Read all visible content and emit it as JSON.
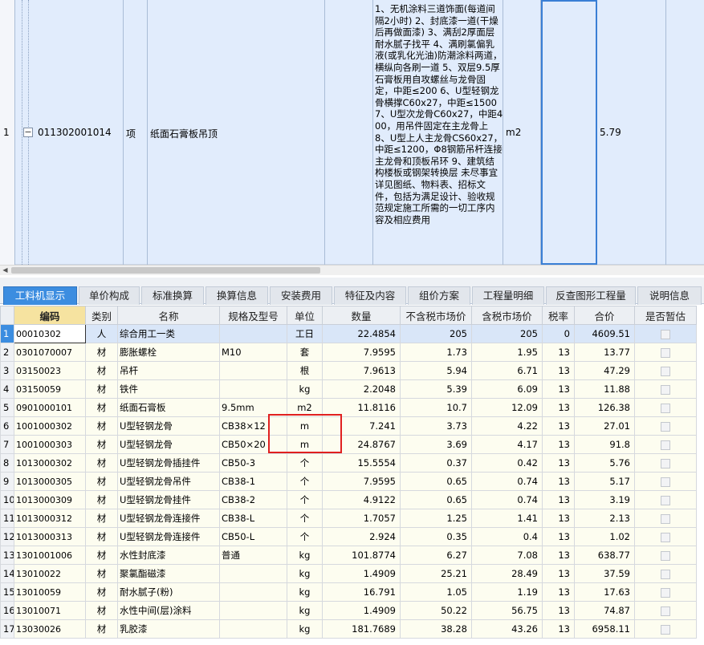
{
  "top_item": {
    "row_number": "1",
    "code": "011302001014",
    "type": "项",
    "name": "纸面石膏板吊顶",
    "features": "1、无机涂料三道饰面(每道间隔2小时)\n2、封底漆一道(干燥后再做面漆)\n3、满刮2厚面层耐水腻子找平\n4、满刷氯偏乳液(或乳化光油)防潮涂料两道，横纵向各刷一道\n5、双层9.5厚石膏板用自攻螺丝与龙骨固定，中距≤200\n6、U型轻钢龙骨横撑C60x27，中距≤1500\n7、U型次龙骨C60x27，中距400，用吊件固定在主龙骨上\n8、U型上人主龙骨CS60x27，中距≤1200，Φ8钢筋吊杆连接主龙骨和顶板吊环\n9、建筑结构楼板或钢架转换层\n未尽事宜详见图纸、物料表、招标文件，包括为满足设计、验收规范规定施工所需的一切工序内容及相应费用",
    "unit": "m2",
    "quantity": "5.79",
    "expander_symbol": "−"
  },
  "tabs": [
    {
      "label": "工料机显示",
      "active": true
    },
    {
      "label": "单价构成"
    },
    {
      "label": "标准换算"
    },
    {
      "label": "换算信息"
    },
    {
      "label": "安装费用"
    },
    {
      "label": "特征及内容"
    },
    {
      "label": "组价方案"
    },
    {
      "label": "工程量明细"
    },
    {
      "label": "反查图形工程量"
    },
    {
      "label": "说明信息"
    }
  ],
  "columns": [
    "编码",
    "类别",
    "名称",
    "规格及型号",
    "单位",
    "数量",
    "不含税市场价",
    "含税市场价",
    "税率",
    "合价",
    "是否暂估"
  ],
  "rows": [
    {
      "n": "1",
      "code": "00010302",
      "type": "人",
      "name": "综合用工一类",
      "spec": "",
      "unit": "工日",
      "qty": "22.4854",
      "price_ex": "205",
      "price_in": "205",
      "tax": "0",
      "total": "4609.51"
    },
    {
      "n": "2",
      "code": "0301070007",
      "type": "材",
      "name": "膨胀螺栓",
      "spec": "M10",
      "unit": "套",
      "qty": "7.9595",
      "price_ex": "1.73",
      "price_in": "1.95",
      "tax": "13",
      "total": "13.77"
    },
    {
      "n": "3",
      "code": "03150023",
      "type": "材",
      "name": "吊杆",
      "spec": "",
      "unit": "根",
      "qty": "7.9613",
      "price_ex": "5.94",
      "price_in": "6.71",
      "tax": "13",
      "total": "47.29"
    },
    {
      "n": "4",
      "code": "03150059",
      "type": "材",
      "name": "铁件",
      "spec": "",
      "unit": "kg",
      "qty": "2.2048",
      "price_ex": "5.39",
      "price_in": "6.09",
      "tax": "13",
      "total": "11.88"
    },
    {
      "n": "5",
      "code": "0901000101",
      "type": "材",
      "name": "纸面石膏板",
      "spec": "9.5mm",
      "unit": "m2",
      "qty": "11.8116",
      "price_ex": "10.7",
      "price_in": "12.09",
      "tax": "13",
      "total": "126.38"
    },
    {
      "n": "6",
      "code": "1001000302",
      "type": "材",
      "name": "U型轻钢龙骨",
      "spec": "CB38×12",
      "unit": "m",
      "qty": "7.241",
      "price_ex": "3.73",
      "price_in": "4.22",
      "tax": "13",
      "total": "27.01"
    },
    {
      "n": "7",
      "code": "1001000303",
      "type": "材",
      "name": "U型轻钢龙骨",
      "spec": "CB50×20",
      "unit": "m",
      "qty": "24.8767",
      "price_ex": "3.69",
      "price_in": "4.17",
      "tax": "13",
      "total": "91.8"
    },
    {
      "n": "8",
      "code": "1013000302",
      "type": "材",
      "name": "U型轻钢龙骨插挂件",
      "spec": "CB50-3",
      "unit": "个",
      "qty": "15.5554",
      "price_ex": "0.37",
      "price_in": "0.42",
      "tax": "13",
      "total": "5.76"
    },
    {
      "n": "9",
      "code": "1013000305",
      "type": "材",
      "name": "U型轻钢龙骨吊件",
      "spec": "CB38-1",
      "unit": "个",
      "qty": "7.9595",
      "price_ex": "0.65",
      "price_in": "0.74",
      "tax": "13",
      "total": "5.17"
    },
    {
      "n": "10",
      "code": "1013000309",
      "type": "材",
      "name": "U型轻钢龙骨挂件",
      "spec": "CB38-2",
      "unit": "个",
      "qty": "4.9122",
      "price_ex": "0.65",
      "price_in": "0.74",
      "tax": "13",
      "total": "3.19"
    },
    {
      "n": "11",
      "code": "1013000312",
      "type": "材",
      "name": "U型轻钢龙骨连接件",
      "spec": "CB38-L",
      "unit": "个",
      "qty": "1.7057",
      "price_ex": "1.25",
      "price_in": "1.41",
      "tax": "13",
      "total": "2.13"
    },
    {
      "n": "12",
      "code": "1013000313",
      "type": "材",
      "name": "U型轻钢龙骨连接件",
      "spec": "CB50-L",
      "unit": "个",
      "qty": "2.924",
      "price_ex": "0.35",
      "price_in": "0.4",
      "tax": "13",
      "total": "1.02"
    },
    {
      "n": "13",
      "code": "1301001006",
      "type": "材",
      "name": "水性封底漆",
      "spec": "普通",
      "unit": "kg",
      "qty": "101.8774",
      "price_ex": "6.27",
      "price_in": "7.08",
      "tax": "13",
      "total": "638.77"
    },
    {
      "n": "14",
      "code": "13010022",
      "type": "材",
      "name": "聚氯酯磁漆",
      "spec": "",
      "unit": "kg",
      "qty": "1.4909",
      "price_ex": "25.21",
      "price_in": "28.49",
      "tax": "13",
      "total": "37.59"
    },
    {
      "n": "15",
      "code": "13010059",
      "type": "材",
      "name": "耐水腻子(粉)",
      "spec": "",
      "unit": "kg",
      "qty": "16.791",
      "price_ex": "1.05",
      "price_in": "1.19",
      "tax": "13",
      "total": "17.63"
    },
    {
      "n": "16",
      "code": "13010071",
      "type": "材",
      "name": "水性中间(层)涂料",
      "spec": "",
      "unit": "kg",
      "qty": "1.4909",
      "price_ex": "50.22",
      "price_in": "56.75",
      "tax": "13",
      "total": "74.87"
    },
    {
      "n": "17",
      "code": "13030026",
      "type": "材",
      "name": "乳胶漆",
      "spec": "",
      "unit": "kg",
      "qty": "181.7689",
      "price_ex": "38.28",
      "price_in": "43.26",
      "tax": "13",
      "total": "6958.11"
    }
  ]
}
